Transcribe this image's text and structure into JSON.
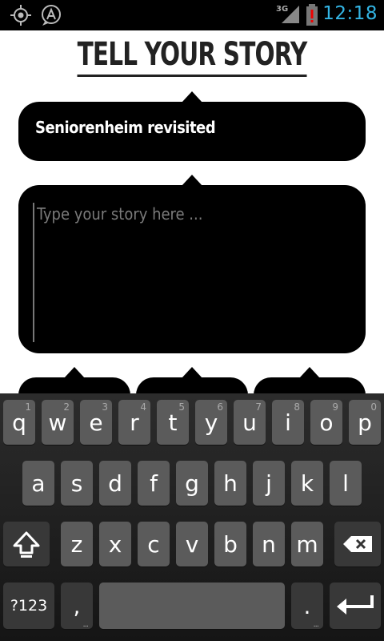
{
  "status_bar": {
    "network": "3G",
    "time": "12:18",
    "icons": [
      "gps-icon",
      "a-notification-icon",
      "signal-icon",
      "battery-alert-icon"
    ]
  },
  "page": {
    "title": "TELL YOUR STORY",
    "name_value": "Seniorenheim revisited",
    "story_placeholder": "Type your story here ..."
  },
  "keyboard": {
    "row1": [
      {
        "label": "q",
        "hint": "1"
      },
      {
        "label": "w",
        "hint": "2"
      },
      {
        "label": "e",
        "hint": "3"
      },
      {
        "label": "r",
        "hint": "4"
      },
      {
        "label": "t",
        "hint": "5"
      },
      {
        "label": "y",
        "hint": "6"
      },
      {
        "label": "u",
        "hint": "7"
      },
      {
        "label": "i",
        "hint": "8"
      },
      {
        "label": "o",
        "hint": "9"
      },
      {
        "label": "p",
        "hint": "0"
      }
    ],
    "row2": [
      "a",
      "s",
      "d",
      "f",
      "g",
      "h",
      "j",
      "k",
      "l"
    ],
    "row3": [
      "z",
      "x",
      "c",
      "v",
      "b",
      "n",
      "m"
    ],
    "symbols_label": "?123",
    "comma_label": ",",
    "period_label": ".",
    "more_hint": "..."
  }
}
